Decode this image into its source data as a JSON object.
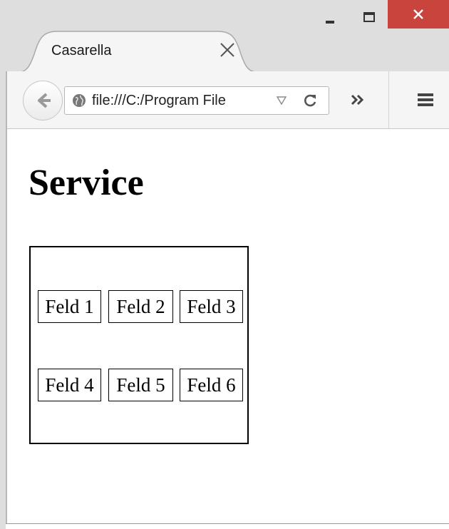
{
  "window": {
    "tab_title": "Casarella",
    "controls": {
      "minimize_icon": "minimize-icon",
      "maximize_icon": "maximize-icon",
      "close_icon": "close-icon",
      "close_color": "#c9443c"
    }
  },
  "navbar": {
    "url": "file:///C:/Program File",
    "back_icon": "back-arrow-icon",
    "site_icon": "globe-icon",
    "overflow_label": "»",
    "menu_icon": "hamburger-menu-icon"
  },
  "page": {
    "heading": "Service",
    "fields": [
      "Feld 1",
      "Feld 2",
      "Feld 3",
      "Feld 4",
      "Feld 5",
      "Feld 6"
    ]
  }
}
